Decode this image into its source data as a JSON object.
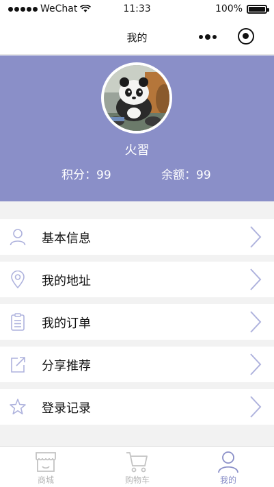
{
  "status_bar": {
    "carrier": "WeChat",
    "time": "11:33",
    "battery": "100%"
  },
  "nav": {
    "title": "我的"
  },
  "profile": {
    "username": "火習",
    "points": "积分：99",
    "balance": "余额：99"
  },
  "menu": {
    "items": [
      {
        "label": "基本信息",
        "icon": "user-icon"
      },
      {
        "label": "我的地址",
        "icon": "location-pin-icon"
      },
      {
        "label": "我的订单",
        "icon": "clipboard-icon"
      },
      {
        "label": "分享推荐",
        "icon": "share-icon"
      },
      {
        "label": "登录记录",
        "icon": "star-icon"
      }
    ]
  },
  "tabbar": {
    "items": [
      {
        "label": "商城",
        "icon": "store-icon",
        "active": false
      },
      {
        "label": "购物车",
        "icon": "cart-icon",
        "active": false
      },
      {
        "label": "我的",
        "icon": "person-icon",
        "active": true
      }
    ]
  },
  "colors": {
    "accent": "#8a8fc8",
    "icon": "#aeb2dd",
    "inactive": "#b5b5b5"
  }
}
